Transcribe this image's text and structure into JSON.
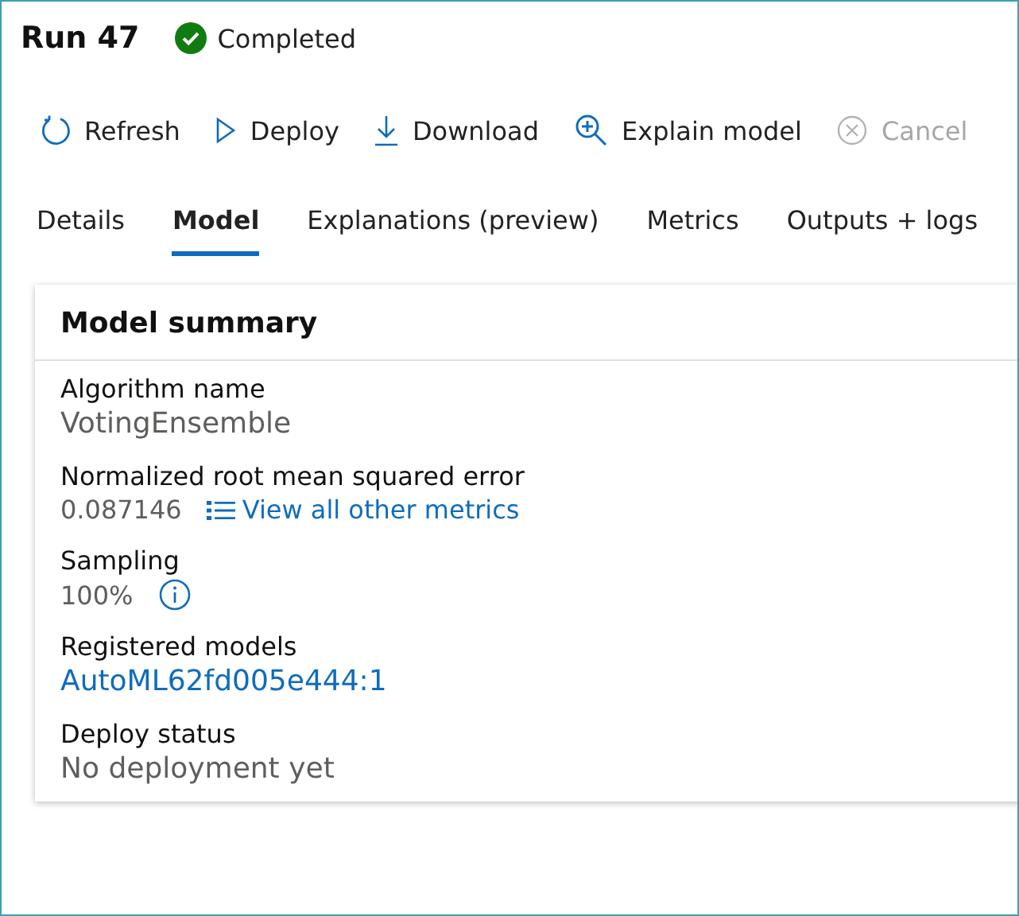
{
  "run": {
    "title": "Run 47",
    "status": "Completed"
  },
  "toolbar": [
    {
      "label": "Refresh",
      "disabled": false
    },
    {
      "label": "Deploy",
      "disabled": false
    },
    {
      "label": "Download",
      "disabled": false
    },
    {
      "label": "Explain model",
      "disabled": false
    },
    {
      "label": "Cancel",
      "disabled": true
    }
  ],
  "tabs": [
    {
      "label": "Details",
      "selected": false
    },
    {
      "label": "Model",
      "selected": true
    },
    {
      "label": "Explanations (preview)",
      "selected": false
    },
    {
      "label": "Metrics",
      "selected": false
    },
    {
      "label": "Outputs + logs",
      "selected": false
    }
  ],
  "summary": {
    "title": "Model summary",
    "fields": [
      {
        "kind": "text",
        "label": "Algorithm name",
        "value": "VotingEnsemble"
      },
      {
        "kind": "text_link",
        "label": "Normalized root mean squared error",
        "value": "0.087146",
        "link": "View all other metrics"
      },
      {
        "kind": "text_info",
        "label": "Sampling",
        "value": "100%"
      },
      {
        "kind": "link",
        "label": "Registered models",
        "value": "AutoML62fd005e444:1"
      },
      {
        "kind": "text",
        "label": "Deploy status",
        "value": "No deployment yet"
      }
    ]
  }
}
